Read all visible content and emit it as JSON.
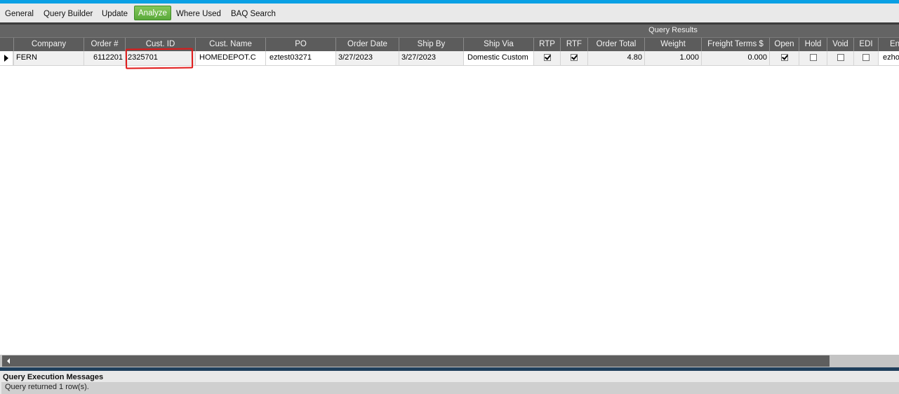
{
  "tabs": [
    {
      "label": "General"
    },
    {
      "label": "Query Builder"
    },
    {
      "label": "Update"
    },
    {
      "label": "Analyze",
      "active": true
    },
    {
      "label": "Where Used"
    },
    {
      "label": "BAQ Search"
    }
  ],
  "grid": {
    "caption": "Query Results",
    "columns": [
      "Company",
      "Order #",
      "Cust. ID",
      "Cust. Name",
      "PO",
      "Order Date",
      "Ship By",
      "Ship Via",
      "RTP",
      "RTF",
      "Order Total",
      "Weight",
      "Freight Terms $",
      "Open",
      "Hold",
      "Void",
      "EDI",
      "En"
    ],
    "row": {
      "company": "FERN",
      "order_num": "6112201",
      "cust_id": "2325701",
      "cust_name": "HOMEDEPOT.C",
      "po": "eztest03271",
      "order_date": "3/27/2023",
      "ship_by": "3/27/2023",
      "ship_via": "Domestic Custom",
      "rtp": true,
      "rtf": true,
      "order_total": "4.80",
      "weight": "1.000",
      "freight_terms": "0.000",
      "open": true,
      "hold": false,
      "void": false,
      "edi": false,
      "en": "ezho"
    }
  },
  "messages": {
    "title": "Query Execution Messages",
    "text": "Query returned 1 row(s)."
  },
  "colors": {
    "accent_top": "#0aa0e4",
    "active_tab": "#6bb845",
    "header_bg": "#5c5c5c",
    "annotation": "#e01818"
  }
}
